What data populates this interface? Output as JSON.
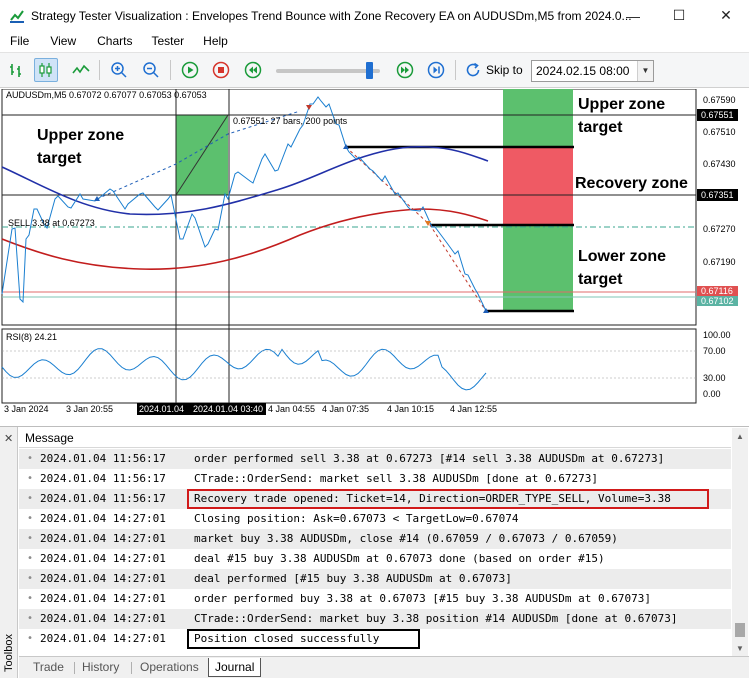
{
  "window": {
    "title": "Strategy Tester Visualization : Envelopes Trend Bounce with Zone Recovery EA on AUDUSDm,M5 from 2024.0...",
    "min_glyph": "—",
    "max_glyph": "☐",
    "close_glyph": "✕"
  },
  "menu": [
    "File",
    "View",
    "Charts",
    "Tester",
    "Help"
  ],
  "toolbar": {
    "skip_label": "Skip to",
    "skip_date": "2024.02.15 08:00"
  },
  "chart": {
    "symbol_info": "AUDUSDm,M5  0.67072 0.67077 0.67053 0.67053",
    "annotation_bars": "0.67551: 27 bars, 200 points",
    "sell_label": "SELL 3.38 at 0.67273",
    "zone_labels": {
      "upper_left_1": "Upper zone",
      "upper_left_2": "target",
      "upper_right_1": "Upper zone",
      "upper_right_2": "target",
      "recovery": "Recovery zone",
      "lower_1": "Lower zone",
      "lower_2": "target"
    },
    "price_ticks": [
      "0.67590",
      "0.67510",
      "0.67430",
      "0.67270",
      "0.67190"
    ],
    "price_boxes": [
      "0.67551",
      "0.67351",
      "0.67116",
      "0.67102"
    ],
    "rsi_label": "RSI(8) 24.21",
    "rsi_ticks": [
      "100.00",
      "70.00",
      "30.00",
      "0.00"
    ],
    "time_labels": [
      "3 Jan 2024",
      "3 Jan 20:55",
      "2024.01.04 03:40",
      "4 Jan 04:55",
      "4 Jan 07:35",
      "4 Jan 10:15",
      "4 Jan 12:55"
    ],
    "time_crosshair_1": "2024.01.04",
    "time_crosshair_2": "2024.01.04 03:40",
    "colors": {
      "green_zone": "#5cc06e",
      "red_zone": "#ef5a64",
      "upper_envelope": "#2130a8",
      "lower_envelope": "#c21d1d",
      "price_line": "#1a7fd0"
    }
  },
  "toolbox": {
    "side_label": "Toolbox",
    "header": "Message",
    "rows": [
      {
        "time": "2024.01.04 11:56:17",
        "msg": "order performed sell 3.38 at 0.67273 [#14 sell 3.38 AUDUSDm at 0.67273]"
      },
      {
        "time": "2024.01.04 11:56:17",
        "msg": "CTrade::OrderSend: market sell 3.38 AUDUSDm [done at 0.67273]"
      },
      {
        "time": "2024.01.04 11:56:17",
        "msg": "Recovery trade opened: Ticket=14, Direction=ORDER_TYPE_SELL, Volume=3.38"
      },
      {
        "time": "2024.01.04 14:27:01",
        "msg": "Closing position: Ask=0.67073 < TargetLow=0.67074"
      },
      {
        "time": "2024.01.04 14:27:01",
        "msg": "market buy 3.38 AUDUSDm, close #14 (0.67059 / 0.67073 / 0.67059)"
      },
      {
        "time": "2024.01.04 14:27:01",
        "msg": "deal #15 buy 3.38 AUDUSDm at 0.67073 done (based on order #15)"
      },
      {
        "time": "2024.01.04 14:27:01",
        "msg": "deal performed [#15 buy 3.38 AUDUSDm at 0.67073]"
      },
      {
        "time": "2024.01.04 14:27:01",
        "msg": "order performed buy 3.38 at 0.67073 [#15 buy 3.38 AUDUSDm at 0.67073]"
      },
      {
        "time": "2024.01.04 14:27:01",
        "msg": "CTrade::OrderSend: market buy 3.38 position #14 AUDUSDm [done at 0.67073]"
      },
      {
        "time": "2024.01.04 14:27:01",
        "msg": "Position closed successfully"
      }
    ],
    "tabs": [
      "Trade",
      "History",
      "Operations",
      "Journal"
    ],
    "active_tab": "Journal"
  }
}
